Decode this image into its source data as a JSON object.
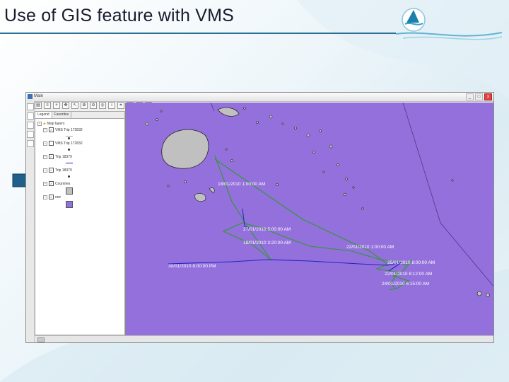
{
  "slide": {
    "title": "Use of GIS feature with VMS"
  },
  "window": {
    "title": "Main",
    "controls": [
      "_",
      "□",
      "x"
    ],
    "toolbar_icons": [
      "layers-icon",
      "list-icon",
      "add-layer-icon",
      "pan-icon",
      "select-icon",
      "zoom-in-icon",
      "zoom-out-icon",
      "full-extent-icon",
      "identify-icon",
      "measure-icon",
      "back-icon",
      "forward-icon",
      "refresh-icon"
    ]
  },
  "legend": {
    "tabs": [
      "Legend",
      "Favorites"
    ],
    "root": "Map layers",
    "layers": [
      {
        "name": "VMS Trip 172832",
        "checked": true,
        "symbol": "dot-line"
      },
      {
        "name": "VMS Trip 172832",
        "checked": false,
        "symbol": "dot"
      },
      {
        "name": "Trip 18379",
        "checked": true,
        "symbol": "blue-line"
      },
      {
        "name": "Trip 18379",
        "checked": true,
        "symbol": "dot"
      },
      {
        "name": "Countries",
        "checked": true,
        "symbol": "grey-box"
      },
      {
        "name": "eez",
        "checked": true,
        "symbol": "purple-box"
      }
    ]
  },
  "map": {
    "labels": [
      "18/01/2010 1:00:00 AM",
      "27/01/2010 5:00:00 AM",
      "18/01/2010 3:20:00 AM",
      "22/01/2010 1:00:00 AM",
      "30/01/2010 8:00:00 PM",
      "25/01/2010 8:00:00 AM",
      "22/01/2010 8:12:00 AM",
      "24/01/2010 6:15:00 AM"
    ]
  },
  "colors": {
    "ocean": "#9370DB",
    "land": "#c0c0c0",
    "track_green": "#2e9a2e",
    "track_blue": "#2323c8",
    "title_rule": "#2a6f97",
    "arrow": "#1f5f8b"
  }
}
